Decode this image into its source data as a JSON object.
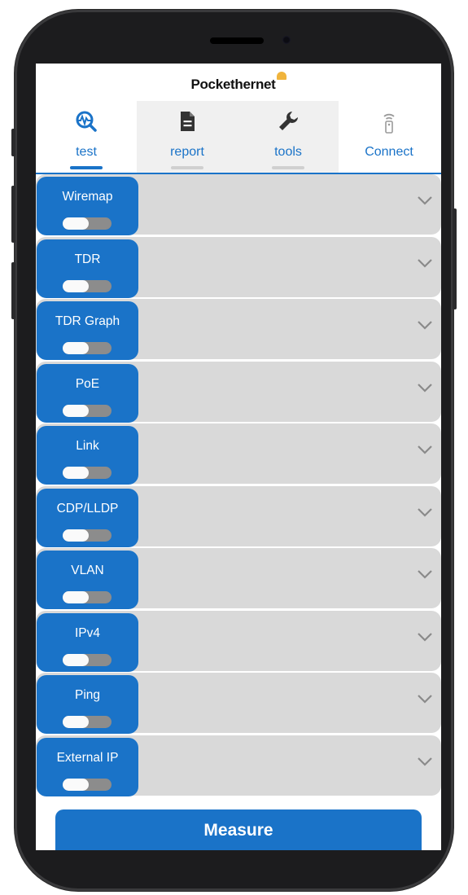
{
  "app": {
    "brand": "Pockethernet"
  },
  "tabs": [
    {
      "label": "test",
      "icon": "waveform-search-icon",
      "active": true
    },
    {
      "label": "report",
      "icon": "document-icon",
      "active": false
    },
    {
      "label": "tools",
      "icon": "wrench-icon",
      "active": false
    },
    {
      "label": "Connect",
      "icon": "device-wifi-icon",
      "active": false
    }
  ],
  "tests": [
    {
      "label": "Wiremap",
      "enabled": false
    },
    {
      "label": "TDR",
      "enabled": false
    },
    {
      "label": "TDR Graph",
      "enabled": false
    },
    {
      "label": "PoE",
      "enabled": false
    },
    {
      "label": "Link",
      "enabled": false
    },
    {
      "label": "CDP/LLDP",
      "enabled": false
    },
    {
      "label": "VLAN",
      "enabled": false
    },
    {
      "label": "IPv4",
      "enabled": false
    },
    {
      "label": "Ping",
      "enabled": false
    },
    {
      "label": "External IP",
      "enabled": false
    }
  ],
  "actions": {
    "measure_label": "Measure"
  },
  "colors": {
    "accent": "#1a73c8",
    "row_bg": "#d9d9d9",
    "brand_mark": "#f0b43c"
  }
}
